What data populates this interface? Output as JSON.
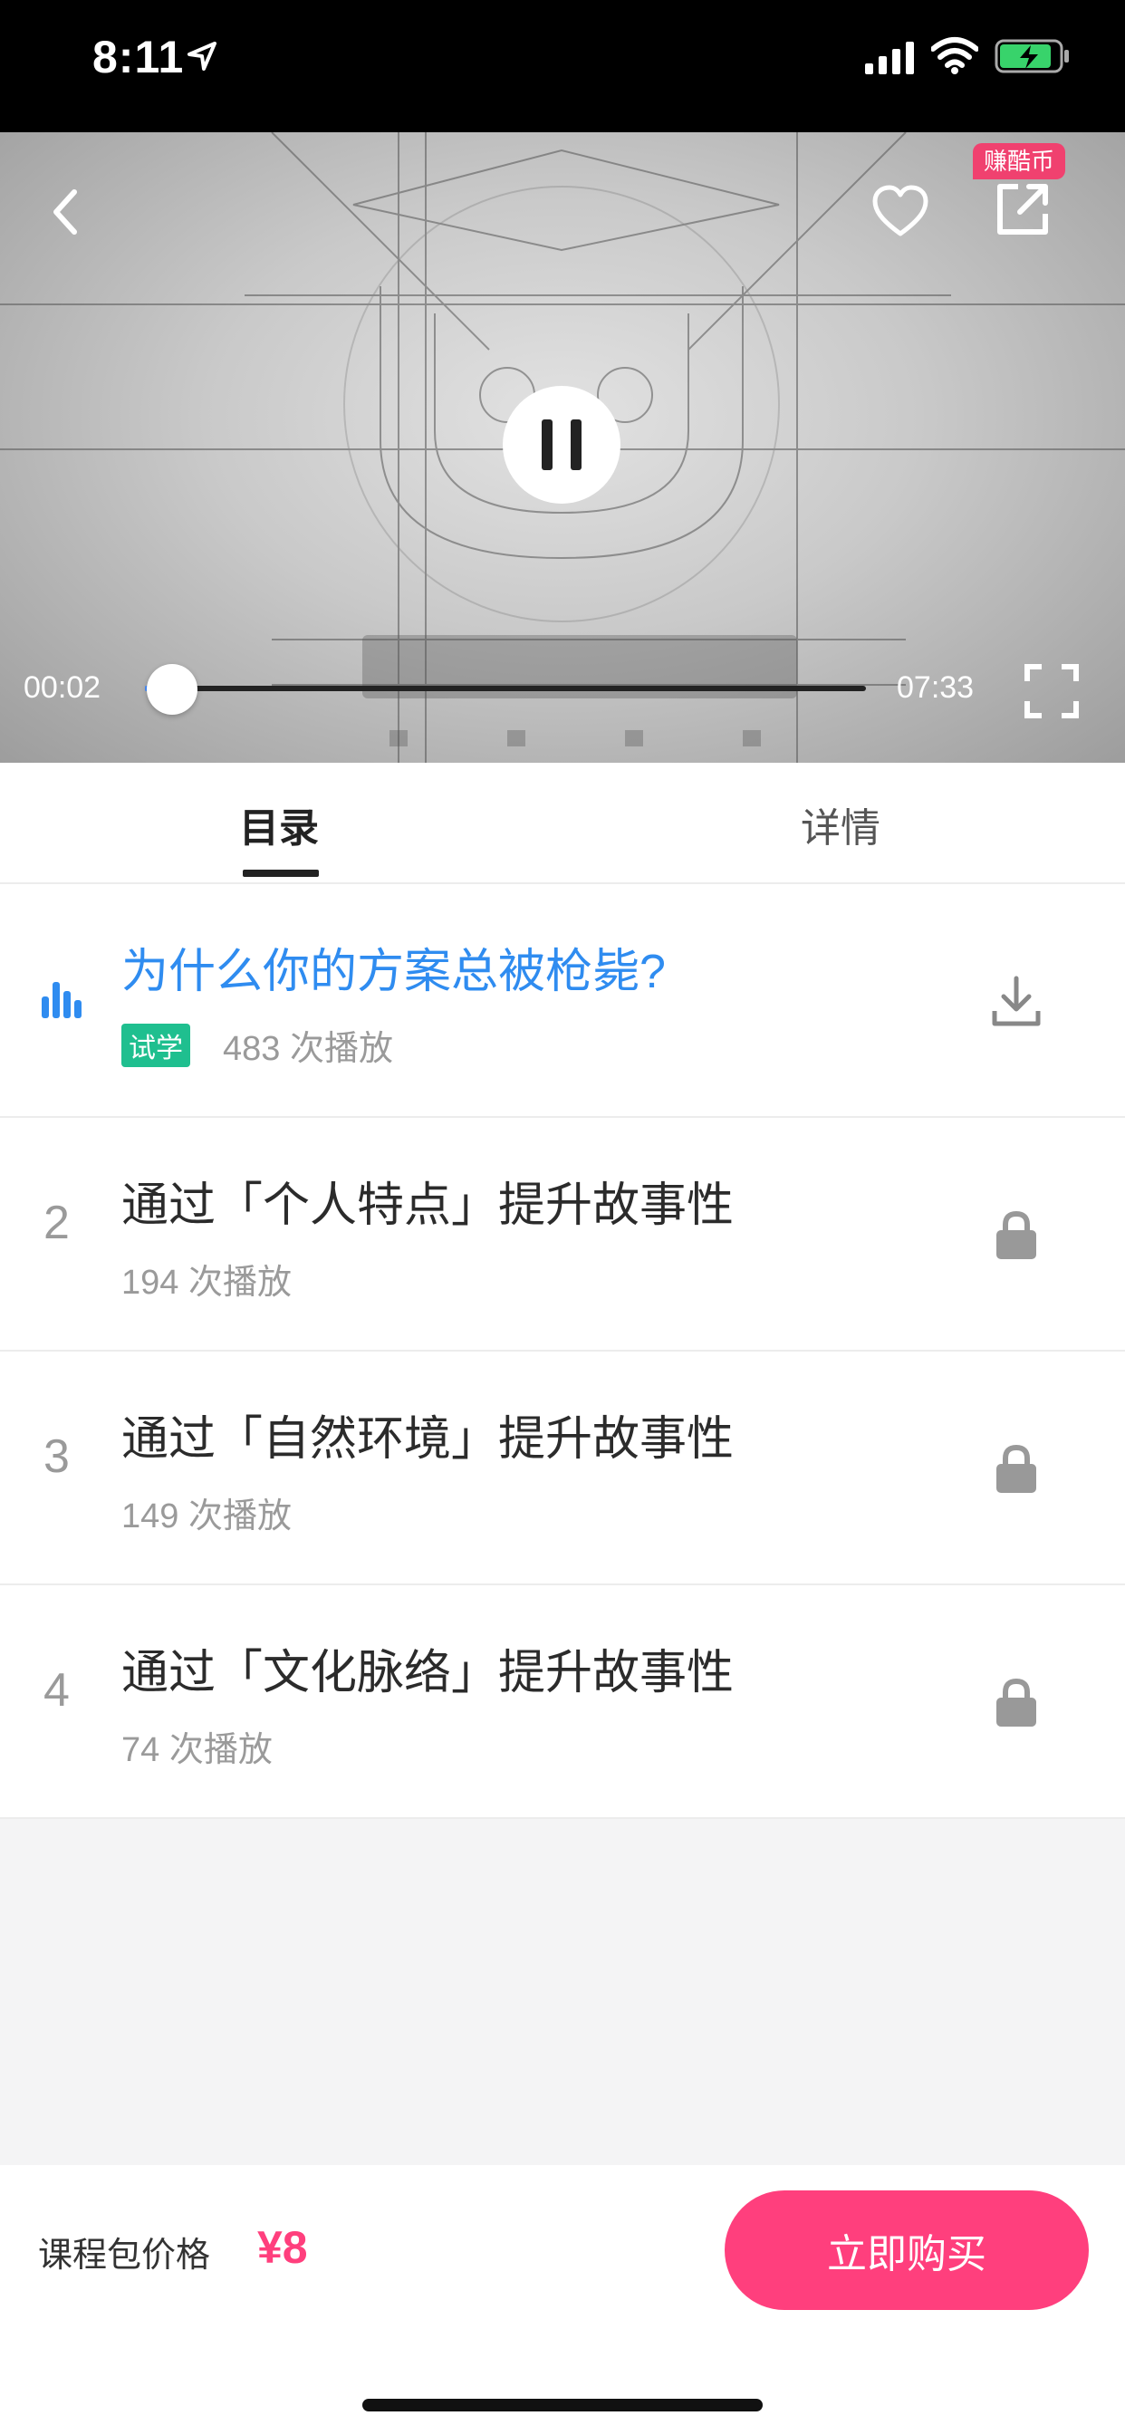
{
  "status_bar": {
    "time": "8:11"
  },
  "video": {
    "badge": "赚酷币",
    "current_time": "00:02",
    "total_time": "07:33",
    "progress": 0.004
  },
  "tabs": [
    {
      "label": "目录",
      "active": true
    },
    {
      "label": "详情",
      "active": false
    }
  ],
  "lessons": [
    {
      "number": "",
      "title": "为什么你的方案总被枪毙?",
      "badge": "试学",
      "plays": "483 次播放",
      "action_icon": "download-icon",
      "active": true
    },
    {
      "number": "2",
      "title": "通过「个人特点」提升故事性",
      "badge": "",
      "plays": "194 次播放",
      "action_icon": "lock-icon",
      "active": false
    },
    {
      "number": "3",
      "title": "通过「自然环境」提升故事性",
      "badge": "",
      "plays": "149 次播放",
      "action_icon": "lock-icon",
      "active": false
    },
    {
      "number": "4",
      "title": "通过「文化脉络」提升故事性",
      "badge": "",
      "plays": "74 次播放",
      "action_icon": "lock-icon",
      "active": false
    }
  ],
  "bottom_bar": {
    "price_label": "课程包价格",
    "price": "¥8",
    "buy_label": "立即购买"
  },
  "colors": {
    "accent_pink": "#ff3f7d",
    "active_blue": "#2f8cf0",
    "trial_green": "#1fbf8f"
  }
}
